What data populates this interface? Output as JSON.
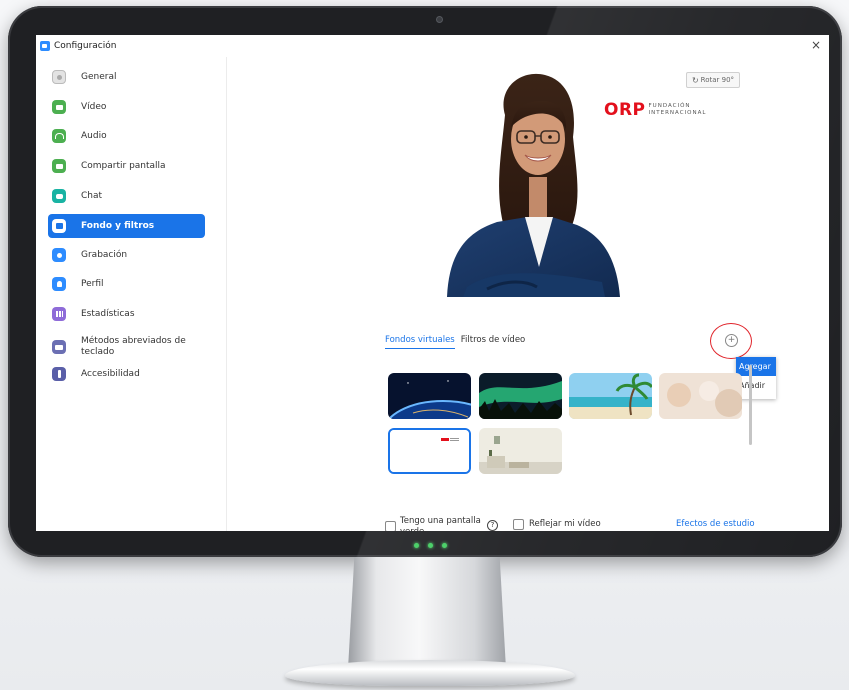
{
  "window": {
    "title": "Configuración",
    "close_glyph": "×"
  },
  "sidebar": {
    "items": [
      {
        "label": "General",
        "icon": "gear-icon",
        "color": "#9e9e9e"
      },
      {
        "label": "Vídeo",
        "icon": "video-icon",
        "color": "#4caf50"
      },
      {
        "label": "Audio",
        "icon": "headphones-icon",
        "color": "#4caf50"
      },
      {
        "label": "Compartir pantalla",
        "icon": "share-screen-icon",
        "color": "#4caf50"
      },
      {
        "label": "Chat",
        "icon": "chat-icon",
        "color": "#19b3a3"
      },
      {
        "label": "Fondo y filtros",
        "icon": "background-icon",
        "color": "#1a74e8"
      },
      {
        "label": "Grabación",
        "icon": "record-icon",
        "color": "#2d8cff"
      },
      {
        "label": "Perfil",
        "icon": "profile-icon",
        "color": "#2d8cff"
      },
      {
        "label": "Estadísticas",
        "icon": "stats-icon",
        "color": "#8e6bd8"
      },
      {
        "label": "Métodos abreviados de teclado",
        "icon": "keyboard-icon",
        "color": "#6b6fb3"
      },
      {
        "label": "Accesibilidad",
        "icon": "accessibility-icon",
        "color": "#5a5fa8"
      }
    ],
    "active_index": 5
  },
  "preview": {
    "rotate_label": "Rotar 90°",
    "logo_mark": "ORP",
    "logo_sub_1": "FUNDACIÓN",
    "logo_sub_2": "INTERNACIONAL"
  },
  "tabs": [
    {
      "label": "Fondos virtuales",
      "active": true
    },
    {
      "label": "Filtros de vídeo",
      "active": false
    }
  ],
  "add_button": {
    "glyph": "+"
  },
  "add_menu": {
    "item_1": "Agregar",
    "item_2": "Añadir"
  },
  "backgrounds": [
    {
      "name": "earth",
      "selected": false
    },
    {
      "name": "aurora",
      "selected": false
    },
    {
      "name": "beach",
      "selected": false
    },
    {
      "name": "blur",
      "selected": false
    },
    {
      "name": "orp-logo",
      "selected": true
    },
    {
      "name": "office",
      "selected": false
    }
  ],
  "bottom": {
    "green_screen_label": "Tengo una pantalla verde",
    "help_glyph": "?",
    "mirror_label": "Reflejar mi vídeo",
    "studio_effects_label": "Efectos de estudio"
  },
  "colors": {
    "accent": "#1a74e8",
    "highlight_ring": "#e0242b",
    "brand_red": "#e3101c"
  }
}
